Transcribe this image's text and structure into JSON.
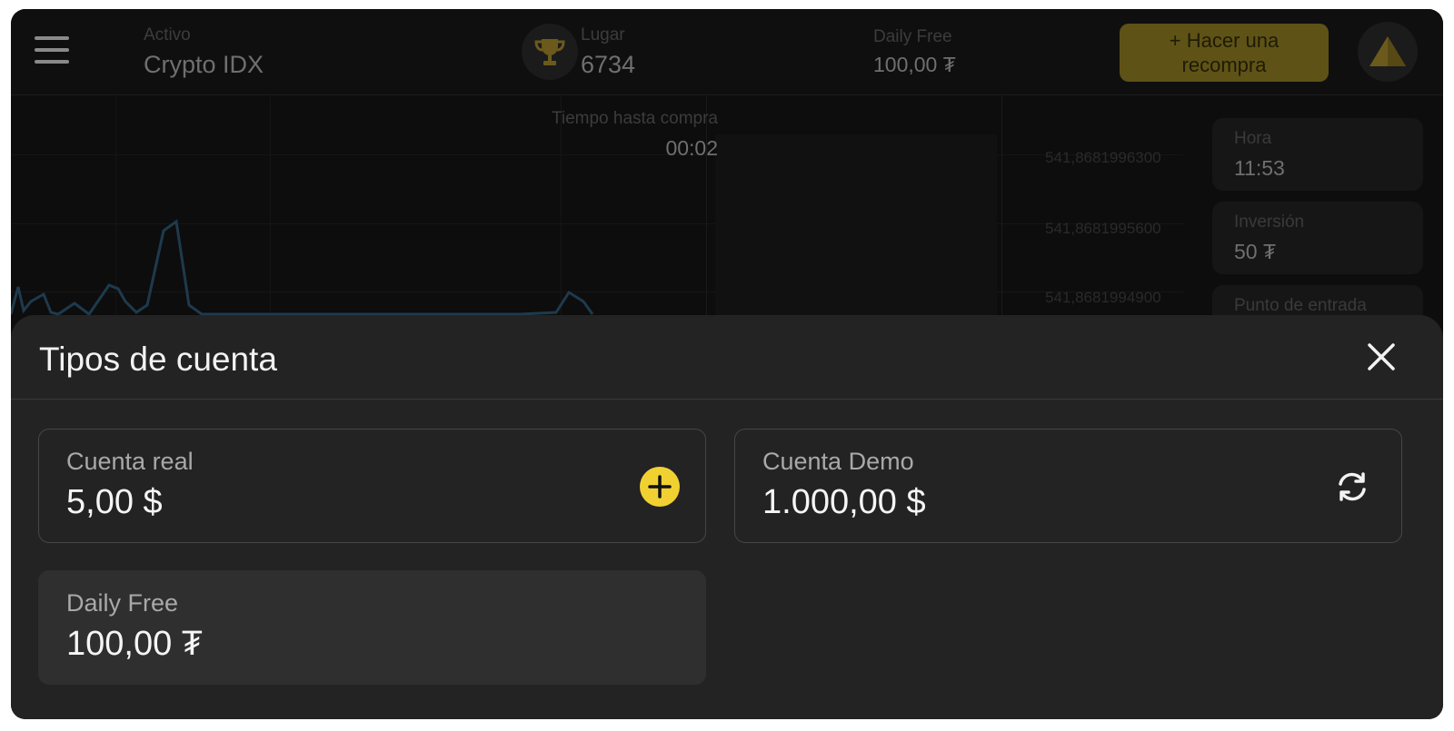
{
  "topbar": {
    "asset_label": "Activo",
    "asset_value": "Crypto IDX",
    "place_label": "Lugar",
    "place_value": "6734",
    "daily_label": "Daily Free",
    "daily_value": "100,00 ₮",
    "rebuy_button": "+ Hacer una recompra"
  },
  "chart": {
    "timer_label": "Tiempo hasta compra",
    "timer_value": "00:02",
    "price_labels": [
      "541,8681996300",
      "541,8681995600",
      "541,8681994900"
    ]
  },
  "side_panel": {
    "time_label": "Hora",
    "time_value": "11:53",
    "investment_label": "Inversión",
    "investment_value": "50 ₮",
    "third_label": "Punto de entrada"
  },
  "modal": {
    "title": "Tipos de cuenta",
    "accounts": [
      {
        "name": "Cuenta real",
        "amount": "5,00 $",
        "action_icon": "plus-icon"
      },
      {
        "name": "Cuenta Demo",
        "amount": "1.000,00 $",
        "action_icon": "refresh-icon"
      },
      {
        "name": "Daily Free",
        "amount": "100,00 ₮"
      }
    ]
  },
  "colors": {
    "accent_yellow": "#f0d131",
    "modal_bg": "#232323",
    "card_border": "#464646"
  }
}
